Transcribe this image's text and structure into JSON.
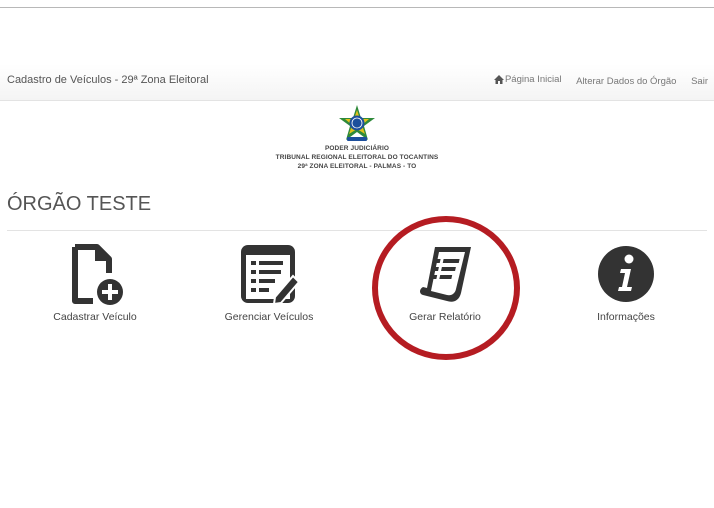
{
  "navbar": {
    "brand": "Cadastro de Veículos - 29ª Zona Eleitoral",
    "links": [
      "Página Inicial",
      "Alterar Dados do Órgão",
      "Sair"
    ]
  },
  "header": {
    "line1": "PODER JUDICIÁRIO",
    "line2": "TRIBUNAL REGIONAL ELEITORAL DO TOCANTINS",
    "line3": "29ª ZONA ELEITORAL - PALMAS - TO"
  },
  "page": {
    "title": "ÓRGÃO TESTE"
  },
  "tiles": [
    {
      "label": "Cadastrar Veículo",
      "icon": "file-add-icon"
    },
    {
      "label": "Gerenciar Veículos",
      "icon": "edit-list-icon"
    },
    {
      "label": "Gerar Relatório",
      "icon": "report-scroll-icon"
    },
    {
      "label": "Informações",
      "icon": "info-icon"
    }
  ],
  "colors": {
    "highlight": "#b51c22",
    "icon": "#333333"
  }
}
